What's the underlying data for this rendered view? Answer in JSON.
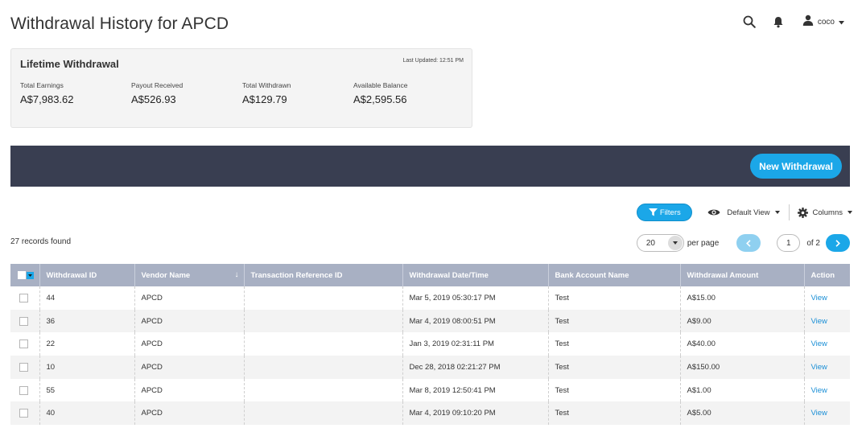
{
  "page": {
    "title": "Withdrawal History for APCD"
  },
  "header": {
    "search_icon": "search-icon",
    "bell_icon": "bell-icon",
    "user_icon": "user-icon",
    "username": "coco"
  },
  "summary": {
    "title": "Lifetime Withdrawal",
    "last_updated": "Last Updated: 12:51 PM",
    "stats": [
      {
        "label": "Total Earnings",
        "value": "A$7,983.62"
      },
      {
        "label": "Payout Received",
        "value": "A$526.93"
      },
      {
        "label": "Total Withdrawn",
        "value": "A$129.79"
      },
      {
        "label": "Available Balance",
        "value": "A$2,595.56"
      }
    ]
  },
  "action_bar": {
    "new_withdrawal_label": "New Withdrawal"
  },
  "toolbar": {
    "filters_label": "Filters",
    "view_label": "Default View",
    "columns_label": "Columns"
  },
  "records_found": "27 records found",
  "pagination": {
    "page_size": "20",
    "per_page_label": "per page",
    "current_page": "1",
    "of_label": "of 2"
  },
  "table": {
    "columns": [
      "Withdrawal ID",
      "Vendor Name",
      "Transaction Reference ID",
      "Withdrawal Date/Time",
      "Bank Account Name",
      "Withdrawal Amount",
      "Action"
    ],
    "sort_indicator": "↓",
    "rows": [
      {
        "id": "44",
        "vendor": "APCD",
        "ref": "",
        "datetime": "Mar 5, 2019 05:30:17 PM",
        "bank": "Test",
        "amount": "A$15.00",
        "action": "View"
      },
      {
        "id": "36",
        "vendor": "APCD",
        "ref": "",
        "datetime": "Mar 4, 2019 08:00:51 PM",
        "bank": "Test",
        "amount": "A$9.00",
        "action": "View"
      },
      {
        "id": "22",
        "vendor": "APCD",
        "ref": "",
        "datetime": "Jan 3, 2019 02:31:11 PM",
        "bank": "Test",
        "amount": "A$40.00",
        "action": "View"
      },
      {
        "id": "10",
        "vendor": "APCD",
        "ref": "",
        "datetime": "Dec 28, 2018 02:21:27 PM",
        "bank": "Test",
        "amount": "A$150.00",
        "action": "View"
      },
      {
        "id": "55",
        "vendor": "APCD",
        "ref": "",
        "datetime": "Mar 8, 2019 12:50:41 PM",
        "bank": "Test",
        "amount": "A$1.00",
        "action": "View"
      },
      {
        "id": "40",
        "vendor": "APCD",
        "ref": "",
        "datetime": "Mar 4, 2019 09:10:20 PM",
        "bank": "Test",
        "amount": "A$5.00",
        "action": "View"
      }
    ]
  },
  "colors": {
    "accent": "#1ba7e8",
    "action_bar": "#393e51",
    "table_header": "#a8b0c3",
    "link": "#1b8fd6"
  }
}
